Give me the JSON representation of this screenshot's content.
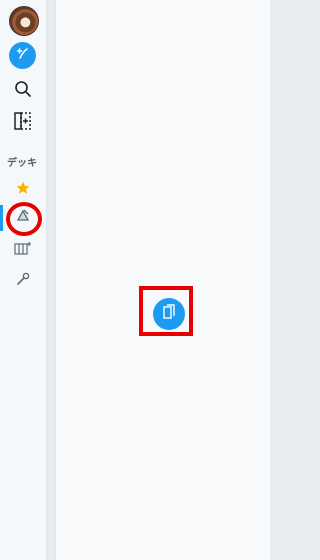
{
  "sidebar": {
    "deck_label": "デッキ",
    "items": [
      {
        "name": "account-avatar"
      },
      {
        "name": "new-tweet"
      },
      {
        "name": "search"
      },
      {
        "name": "add-column"
      },
      {
        "name": "deck-favorite"
      },
      {
        "name": "deck-custom"
      },
      {
        "name": "deck-columns"
      },
      {
        "name": "settings"
      }
    ]
  },
  "main": {
    "empty_state_button_icon": "add-column-icon"
  },
  "colors": {
    "accent": "#1d9bf0",
    "favorite": "#f4b400",
    "highlight": "#e60000"
  }
}
